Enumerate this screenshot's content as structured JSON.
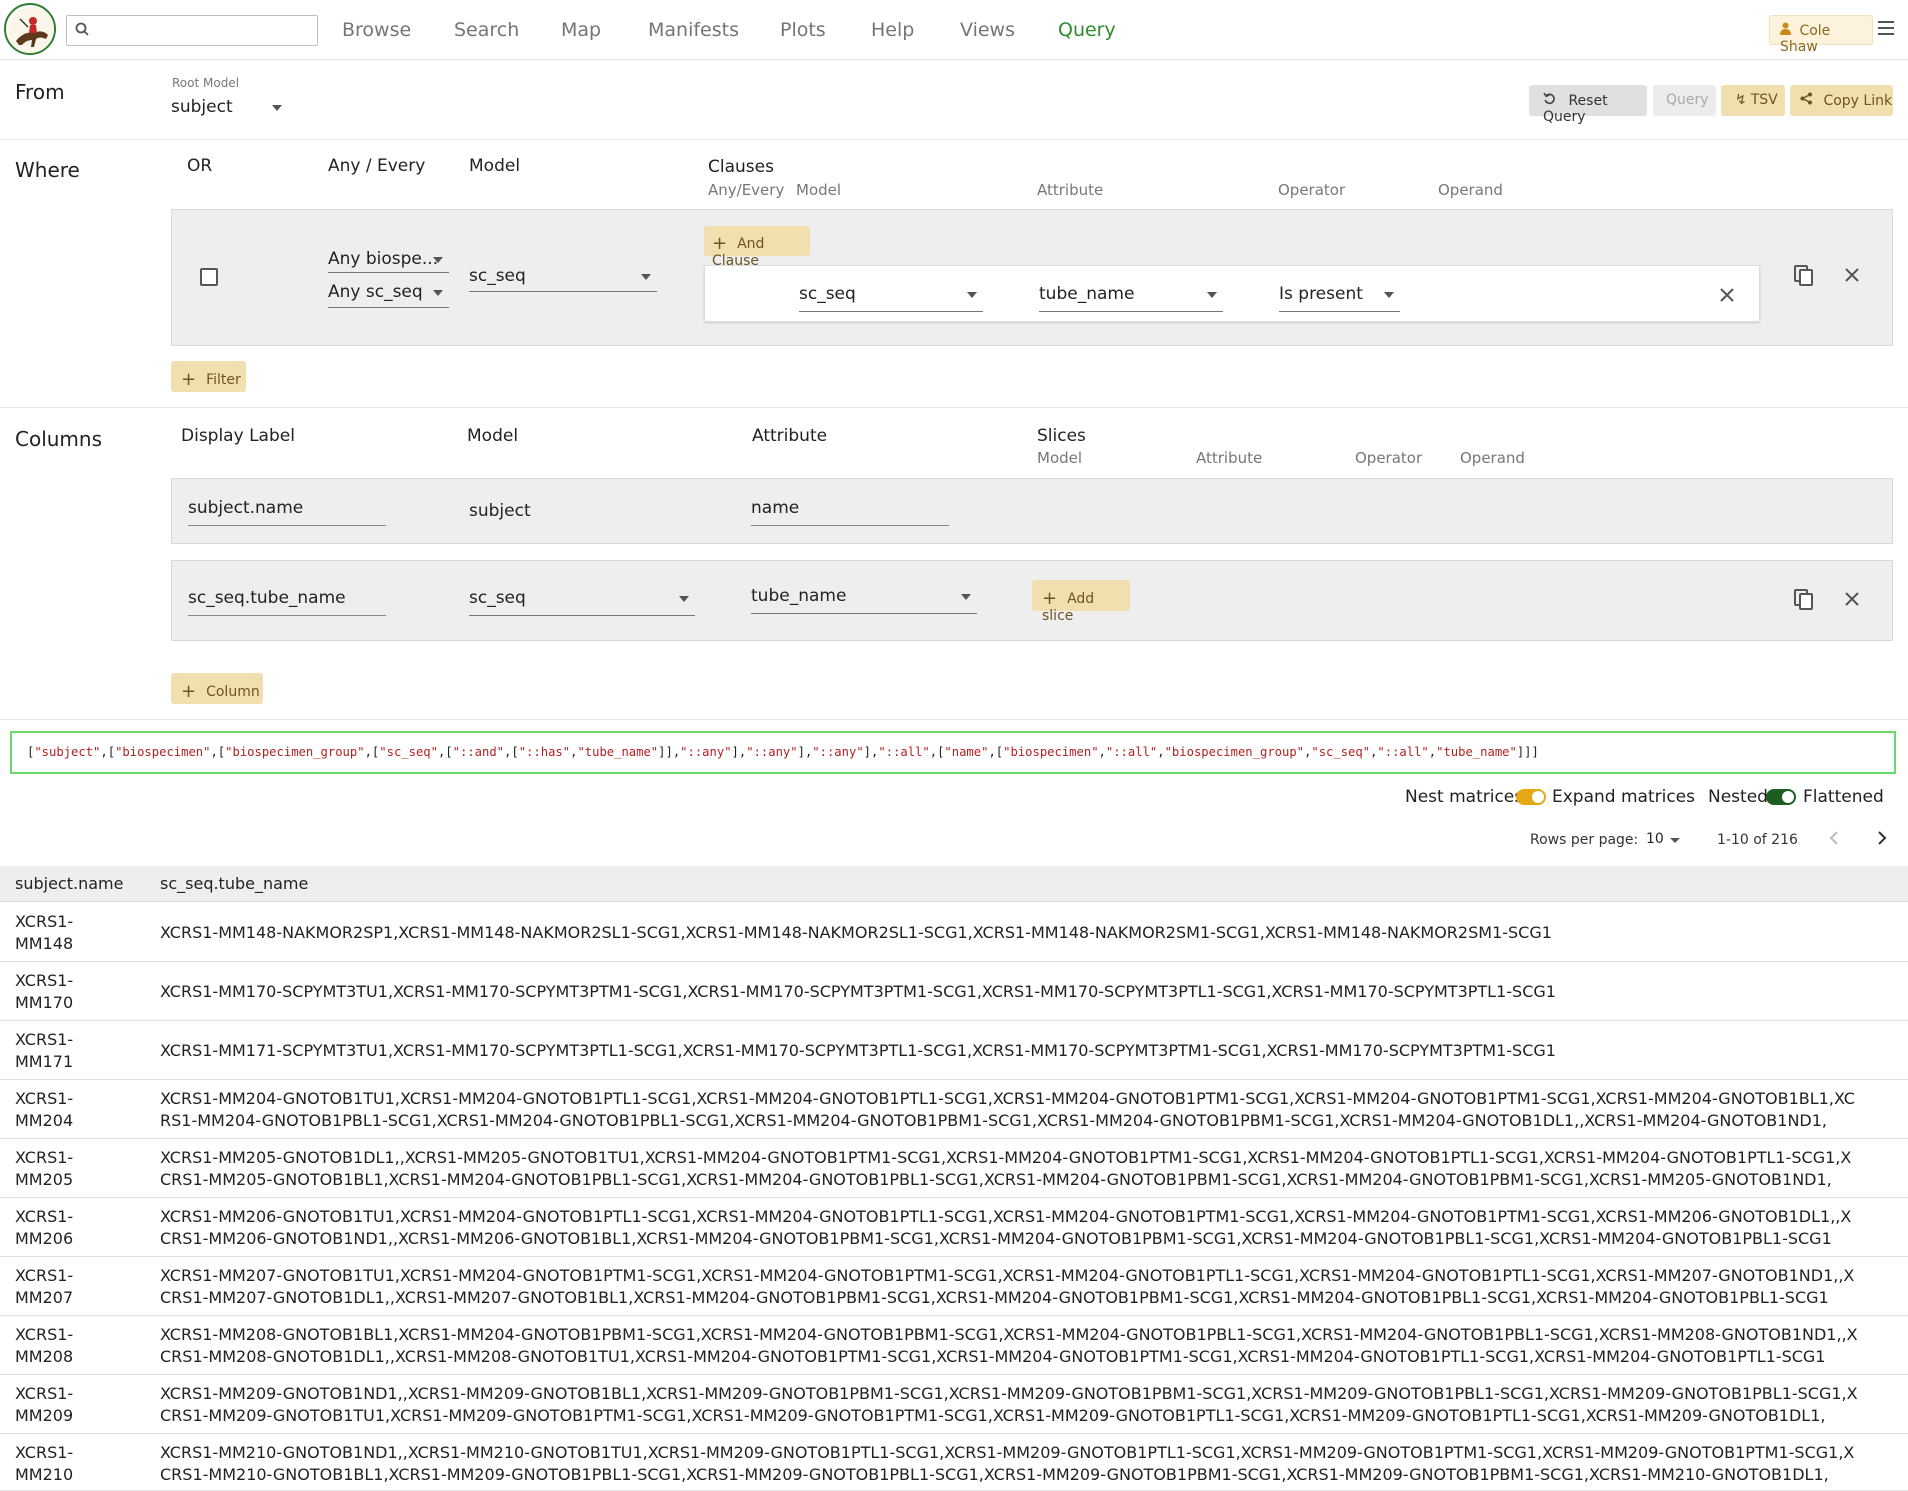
{
  "header": {
    "search_placeholder": "",
    "nav": [
      "Browse",
      "Search",
      "Map",
      "Manifests",
      "Plots",
      "Help",
      "Views",
      "Query"
    ],
    "active_nav": "Query",
    "user": "Cole Shaw"
  },
  "from": {
    "label": "From",
    "root_model_label": "Root Model",
    "root_model": "subject",
    "buttons": {
      "reset": "Reset Query",
      "query": "Query",
      "tsv": "TSV",
      "copy_link": "Copy Link"
    }
  },
  "where": {
    "label": "Where",
    "headers": {
      "or": "OR",
      "any_every": "Any / Every",
      "model": "Model",
      "clauses": "Clauses"
    },
    "clause_subheaders": [
      "Any/Every",
      "Model",
      "Attribute",
      "Operator",
      "Operand"
    ],
    "filter": {
      "any1": "Any biospe...",
      "any2": "Any sc_seq",
      "model": "sc_seq",
      "and_clause_label": "And Clause",
      "clause": {
        "model": "sc_seq",
        "attribute": "tube_name",
        "operator": "Is present"
      }
    },
    "add_filter_label": "Filter"
  },
  "columns": {
    "label": "Columns",
    "headers": {
      "display_label": "Display Label",
      "model": "Model",
      "attribute": "Attribute",
      "slices": "Slices"
    },
    "slice_subheaders": [
      "Model",
      "Attribute",
      "Operator",
      "Operand"
    ],
    "rows": [
      {
        "display_label": "subject.name",
        "model": "subject",
        "attribute": "name"
      },
      {
        "display_label": "sc_seq.tube_name",
        "model": "sc_seq",
        "attribute": "tube_name",
        "add_slice_label": "Add slice"
      }
    ],
    "add_column_label": "Column"
  },
  "query_string": "[\"subject\",[\"biospecimen\",[\"biospecimen_group\",[\"sc_seq\",[\"::and\",[\"::has\",\"tube_name\"]],\"::any\"],\"::any\"],\"::any\"],\"::all\",[\"name\",[\"biospecimen\",\"::all\",\"biospecimen_group\",\"sc_seq\",\"::all\",\"tube_name\"]]]",
  "options": {
    "nest_matrices": "Nest matrices",
    "expand_matrices": "Expand matrices",
    "nested": "Nested",
    "flattened": "Flattened",
    "rows_per_page_label": "Rows per page:",
    "rows_per_page": "10",
    "range": "1-10 of 216",
    "toggle_on_color": "#e6a817",
    "toggle_dark_color": "#1b5e20"
  },
  "table": {
    "headers": [
      "subject.name",
      "sc_seq.tube_name"
    ],
    "rows": [
      {
        "name": "XCRS1-MM148",
        "tube": "XCRS1-MM148-NAKMOR2SP1,XCRS1-MM148-NAKMOR2SL1-SCG1,XCRS1-MM148-NAKMOR2SL1-SCG1,XCRS1-MM148-NAKMOR2SM1-SCG1,XCRS1-MM148-NAKMOR2SM1-SCG1"
      },
      {
        "name": "XCRS1-MM170",
        "tube": "XCRS1-MM170-SCPYMT3TU1,XCRS1-MM170-SCPYMT3PTM1-SCG1,XCRS1-MM170-SCPYMT3PTM1-SCG1,XCRS1-MM170-SCPYMT3PTL1-SCG1,XCRS1-MM170-SCPYMT3PTL1-SCG1"
      },
      {
        "name": "XCRS1-MM171",
        "tube": "XCRS1-MM171-SCPYMT3TU1,XCRS1-MM170-SCPYMT3PTL1-SCG1,XCRS1-MM170-SCPYMT3PTL1-SCG1,XCRS1-MM170-SCPYMT3PTM1-SCG1,XCRS1-MM170-SCPYMT3PTM1-SCG1"
      },
      {
        "name": "XCRS1-MM204",
        "tube": "XCRS1-MM204-GNOTOB1TU1,XCRS1-MM204-GNOTOB1PTL1-SCG1,XCRS1-MM204-GNOTOB1PTL1-SCG1,XCRS1-MM204-GNOTOB1PTM1-SCG1,XCRS1-MM204-GNOTOB1PTM1-SCG1,XCRS1-MM204-GNOTOB1BL1,XCRS1-MM204-GNOTOB1PBL1-SCG1,XCRS1-MM204-GNOTOB1PBL1-SCG1,XCRS1-MM204-GNOTOB1PBM1-SCG1,XCRS1-MM204-GNOTOB1PBM1-SCG1,XCRS1-MM204-GNOTOB1DL1,,XCRS1-MM204-GNOTOB1ND1,"
      },
      {
        "name": "XCRS1-MM205",
        "tube": "XCRS1-MM205-GNOTOB1DL1,,XCRS1-MM205-GNOTOB1TU1,XCRS1-MM204-GNOTOB1PTM1-SCG1,XCRS1-MM204-GNOTOB1PTM1-SCG1,XCRS1-MM204-GNOTOB1PTL1-SCG1,XCRS1-MM204-GNOTOB1PTL1-SCG1,XCRS1-MM205-GNOTOB1BL1,XCRS1-MM204-GNOTOB1PBL1-SCG1,XCRS1-MM204-GNOTOB1PBL1-SCG1,XCRS1-MM204-GNOTOB1PBM1-SCG1,XCRS1-MM204-GNOTOB1PBM1-SCG1,XCRS1-MM205-GNOTOB1ND1,"
      },
      {
        "name": "XCRS1-MM206",
        "tube": "XCRS1-MM206-GNOTOB1TU1,XCRS1-MM204-GNOTOB1PTL1-SCG1,XCRS1-MM204-GNOTOB1PTL1-SCG1,XCRS1-MM204-GNOTOB1PTM1-SCG1,XCRS1-MM204-GNOTOB1PTM1-SCG1,XCRS1-MM206-GNOTOB1DL1,,XCRS1-MM206-GNOTOB1ND1,,XCRS1-MM206-GNOTOB1BL1,XCRS1-MM204-GNOTOB1PBM1-SCG1,XCRS1-MM204-GNOTOB1PBM1-SCG1,XCRS1-MM204-GNOTOB1PBL1-SCG1,XCRS1-MM204-GNOTOB1PBL1-SCG1"
      },
      {
        "name": "XCRS1-MM207",
        "tube": "XCRS1-MM207-GNOTOB1TU1,XCRS1-MM204-GNOTOB1PTM1-SCG1,XCRS1-MM204-GNOTOB1PTM1-SCG1,XCRS1-MM204-GNOTOB1PTL1-SCG1,XCRS1-MM204-GNOTOB1PTL1-SCG1,XCRS1-MM207-GNOTOB1ND1,,XCRS1-MM207-GNOTOB1DL1,,XCRS1-MM207-GNOTOB1BL1,XCRS1-MM204-GNOTOB1PBM1-SCG1,XCRS1-MM204-GNOTOB1PBM1-SCG1,XCRS1-MM204-GNOTOB1PBL1-SCG1,XCRS1-MM204-GNOTOB1PBL1-SCG1"
      },
      {
        "name": "XCRS1-MM208",
        "tube": "XCRS1-MM208-GNOTOB1BL1,XCRS1-MM204-GNOTOB1PBM1-SCG1,XCRS1-MM204-GNOTOB1PBM1-SCG1,XCRS1-MM204-GNOTOB1PBL1-SCG1,XCRS1-MM204-GNOTOB1PBL1-SCG1,XCRS1-MM208-GNOTOB1ND1,,XCRS1-MM208-GNOTOB1DL1,,XCRS1-MM208-GNOTOB1TU1,XCRS1-MM204-GNOTOB1PTM1-SCG1,XCRS1-MM204-GNOTOB1PTM1-SCG1,XCRS1-MM204-GNOTOB1PTL1-SCG1,XCRS1-MM204-GNOTOB1PTL1-SCG1"
      },
      {
        "name": "XCRS1-MM209",
        "tube": "XCRS1-MM209-GNOTOB1ND1,,XCRS1-MM209-GNOTOB1BL1,XCRS1-MM209-GNOTOB1PBM1-SCG1,XCRS1-MM209-GNOTOB1PBM1-SCG1,XCRS1-MM209-GNOTOB1PBL1-SCG1,XCRS1-MM209-GNOTOB1PBL1-SCG1,XCRS1-MM209-GNOTOB1TU1,XCRS1-MM209-GNOTOB1PTM1-SCG1,XCRS1-MM209-GNOTOB1PTM1-SCG1,XCRS1-MM209-GNOTOB1PTL1-SCG1,XCRS1-MM209-GNOTOB1PTL1-SCG1,XCRS1-MM209-GNOTOB1DL1,"
      },
      {
        "name": "XCRS1-MM210",
        "tube": "XCRS1-MM210-GNOTOB1ND1,,XCRS1-MM210-GNOTOB1TU1,XCRS1-MM209-GNOTOB1PTL1-SCG1,XCRS1-MM209-GNOTOB1PTL1-SCG1,XCRS1-MM209-GNOTOB1PTM1-SCG1,XCRS1-MM209-GNOTOB1PTM1-SCG1,XCRS1-MM210-GNOTOB1BL1,XCRS1-MM209-GNOTOB1PBL1-SCG1,XCRS1-MM209-GNOTOB1PBL1-SCG1,XCRS1-MM209-GNOTOB1PBM1-SCG1,XCRS1-MM209-GNOTOB1PBM1-SCG1,XCRS1-MM210-GNOTOB1DL1,"
      }
    ]
  }
}
